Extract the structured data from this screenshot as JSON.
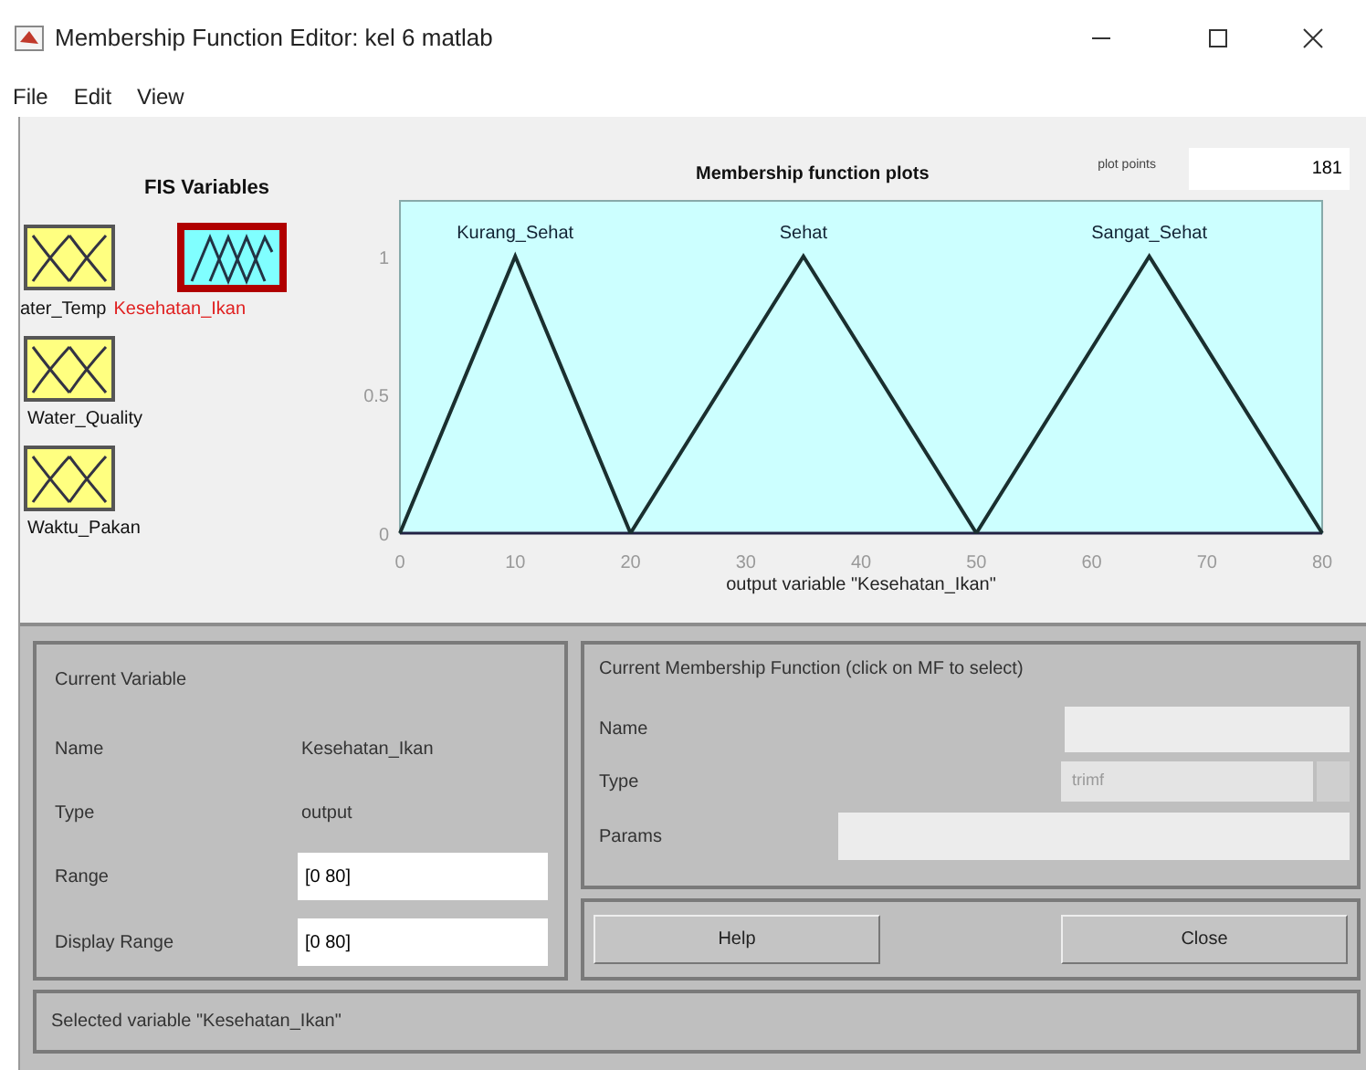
{
  "window": {
    "title": "Membership Function Editor: kel 6 matlab"
  },
  "menu": [
    "File",
    "Edit",
    "View"
  ],
  "fis_variables": {
    "title": "FIS Variables",
    "items": [
      {
        "name": "ater_Temp",
        "kind": "input",
        "selected": false
      },
      {
        "name": "Kesehatan_Ikan",
        "kind": "output",
        "selected": true
      },
      {
        "name": "Water_Quality",
        "kind": "input",
        "selected": false
      },
      {
        "name": "Waktu_Pakan",
        "kind": "input",
        "selected": false
      }
    ]
  },
  "plot": {
    "plot_points_label": "plot points",
    "plot_points": "181",
    "chart_data": {
      "type": "line",
      "title": "Membership function plots",
      "xlabel": "output variable \"Kesehatan_Ikan\"",
      "x": [
        0,
        10,
        20,
        35,
        50,
        65,
        80
      ],
      "series": [
        {
          "name": "Kurang_Sehat",
          "values": [
            0,
            1,
            0,
            null,
            null,
            null,
            null
          ]
        },
        {
          "name": "Sehat",
          "values": [
            null,
            null,
            0,
            1,
            0,
            null,
            null
          ]
        },
        {
          "name": "Sangat_Sehat",
          "values": [
            null,
            null,
            null,
            null,
            0,
            1,
            0
          ]
        }
      ],
      "xlim": [
        0,
        80
      ],
      "ylim": [
        0,
        1.2
      ],
      "xticks": [
        0,
        10,
        20,
        30,
        40,
        50,
        60,
        70,
        80
      ],
      "yticks": [
        0,
        0.5,
        1
      ]
    }
  },
  "current_variable": {
    "title": "Current Variable",
    "name_label": "Name",
    "name": "Kesehatan_Ikan",
    "type_label": "Type",
    "type": "output",
    "range_label": "Range",
    "range": "[0 80]",
    "display_range_label": "Display Range",
    "display_range": "[0 80]"
  },
  "current_mf": {
    "title": "Current Membership Function (click on MF to select)",
    "name_label": "Name",
    "type_label": "Type",
    "type": "trimf",
    "type_disabled": true,
    "params_label": "Params"
  },
  "buttons": [
    "Help",
    "Close"
  ],
  "status": "Selected variable \"Kesehatan_Ikan\""
}
